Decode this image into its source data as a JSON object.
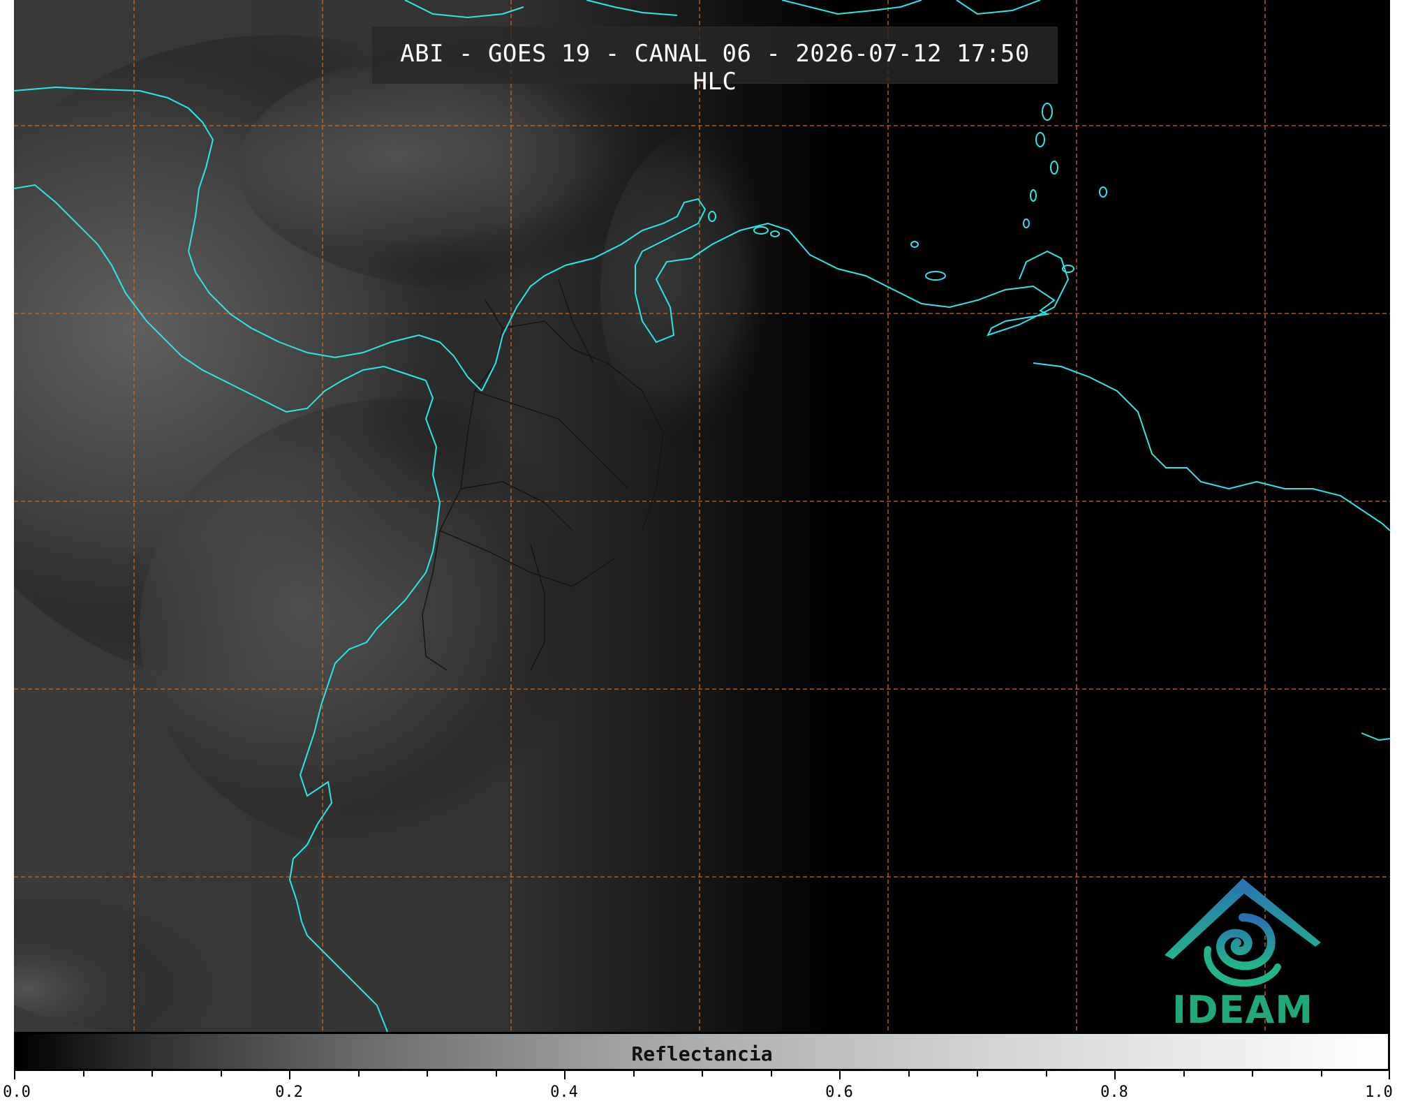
{
  "title": "ABI - GOES 19 - CANAL 06 - 2026-07-12 17:50 HLC",
  "logo": {
    "text": "IDEAM",
    "icon": "ideam-logo-icon"
  },
  "colorbar": {
    "label": "Reflectancia",
    "range": [
      0.0,
      1.0
    ],
    "ticks": [
      "0.0",
      "0.2",
      "0.4",
      "0.6",
      "0.8",
      "1.0"
    ],
    "colors": [
      "#000000",
      "#ffffff"
    ]
  },
  "colors": {
    "coastline": "#2ee6e6",
    "gridline": "#d2691e",
    "borders": "#1a1a1a"
  }
}
